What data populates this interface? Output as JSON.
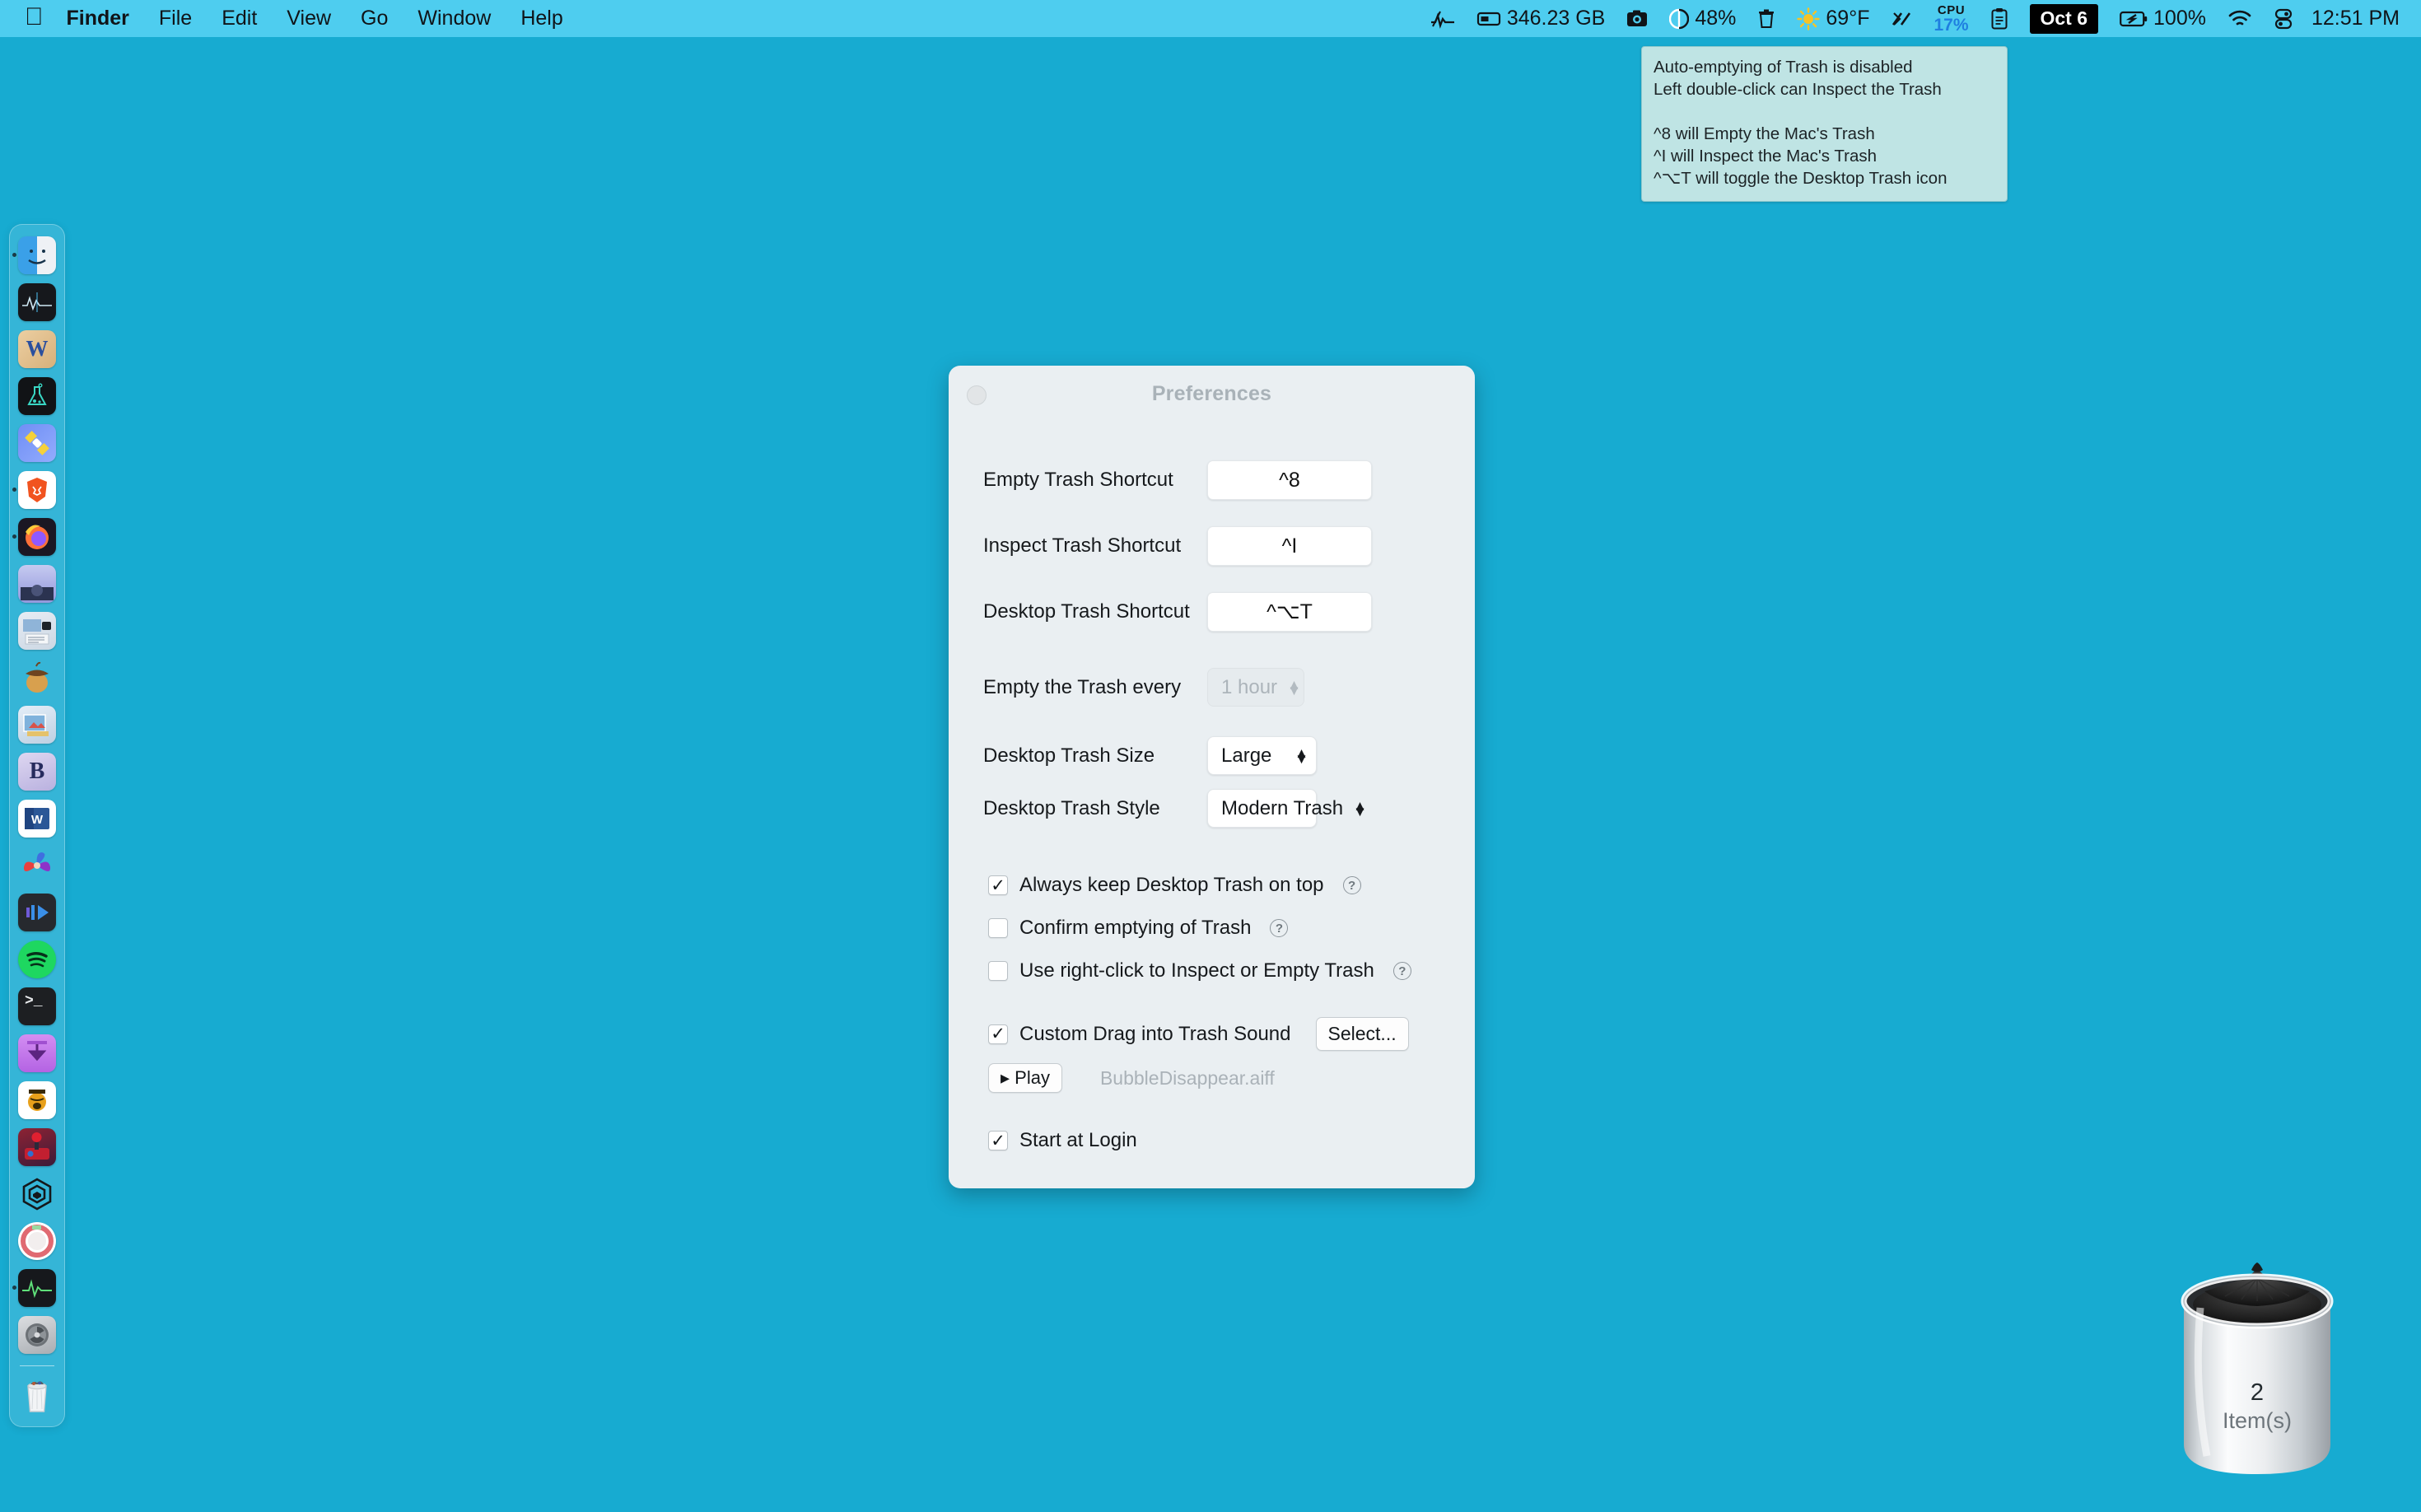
{
  "desktop": {
    "background_color": "#17abd1"
  },
  "menubar": {
    "background_color": "#4ecdef",
    "apple_glyph": "",
    "apps": [
      {
        "label": "Finder",
        "bold": true
      },
      {
        "label": "File",
        "bold": false
      },
      {
        "label": "Edit",
        "bold": false
      },
      {
        "label": "View",
        "bold": false
      },
      {
        "label": "Go",
        "bold": false
      },
      {
        "label": "Window",
        "bold": false
      },
      {
        "label": "Help",
        "bold": false
      }
    ],
    "status": {
      "signal_icon": "waveform-icon",
      "disk_icon": "disk-icon",
      "disk_free": "346.23 GB",
      "camera_icon": "camera-icon",
      "memory_icon": "pie-gauge-icon",
      "memory_pct": "48%",
      "trash_icon": "trash-icon",
      "weather_icon": "sun-icon",
      "weather_temp": "69°F",
      "network_icon": "network-activity-icon",
      "cpu_label": "CPU",
      "cpu_value": "17%",
      "cpu_color": "#1f7fe0",
      "clipboard_icon": "clipboard-icon",
      "date_badge": "Oct 6",
      "battery_icon": "battery-charging-icon",
      "battery_pct": "100%",
      "wifi_icon": "wifi-icon",
      "control_center_icon": "control-center-icon",
      "clock": "12:51 PM"
    }
  },
  "tooltip": {
    "background_color": "#bfe4e4",
    "line1": "Auto-emptying of Trash is disabled",
    "line2": "Left double-click can Inspect the Trash",
    "line3": "^8 will Empty the Mac's Trash",
    "line4": "^I will Inspect the Mac's Trash",
    "line5": "^⌥T will toggle the Desktop Trash icon"
  },
  "dock": {
    "items": [
      {
        "name": "finder",
        "glyph": "",
        "bg": "linear-gradient(135deg,#3fa9f5 0%,#3fa9f5 49%,#f2f4f7 49%,#e8ebef 100%)",
        "color": "#123",
        "running": true
      },
      {
        "name": "istat-menus",
        "glyph": "",
        "bg": "#16181c",
        "color": "#9de3ff",
        "running": false
      },
      {
        "name": "dictionary",
        "glyph": "W",
        "bg": "linear-gradient(135deg,#e6c79a,#d8b27e)",
        "color": "#2b4f9e",
        "running": false
      },
      {
        "name": "science-app",
        "glyph": "",
        "bg": "#111316",
        "color": "#39d7c4",
        "running": false
      },
      {
        "name": "satellite-app",
        "glyph": "",
        "bg": "linear-gradient(135deg,#6f8ef5,#8aa5fb)",
        "color": "#ffd84a",
        "running": false
      },
      {
        "name": "brave-browser",
        "glyph": "",
        "bg": "#ffffff",
        "color": "#f1531f",
        "running": true
      },
      {
        "name": "firefox",
        "glyph": "",
        "bg": "#1b1723",
        "color": "#ff9500",
        "running": true
      },
      {
        "name": "messages-app",
        "glyph": "",
        "bg": "linear-gradient(180deg,#c3c7ef,#8e93d8)",
        "color": "#2b3350",
        "running": false
      },
      {
        "name": "screenshot-app",
        "glyph": "",
        "bg": "linear-gradient(160deg,#dfe6ef,#c7d2de)",
        "color": "#1c2530",
        "running": false
      },
      {
        "name": "acorn-editor",
        "glyph": "",
        "bg": "transparent",
        "color": "#8a5a25",
        "running": false
      },
      {
        "name": "graphic-app",
        "glyph": "",
        "bg": "linear-gradient(160deg,#dfe9f4,#b9cde0)",
        "color": "#c94d3a",
        "running": false
      },
      {
        "name": "bookends-app",
        "glyph": "B",
        "bg": "linear-gradient(160deg,#d9d3ee,#bdb5e0)",
        "color": "#2b2f63",
        "running": false
      },
      {
        "name": "microsoft-word",
        "glyph": "W",
        "bg": "#ffffff",
        "color": "#2b5797",
        "running": false
      },
      {
        "name": "swirl-app",
        "glyph": "",
        "bg": "transparent",
        "color": "#8d33c8",
        "running": false
      },
      {
        "name": "media-player",
        "glyph": "▶",
        "bg": "#26292e",
        "color": "#5fb9ff",
        "running": false
      },
      {
        "name": "spotify",
        "glyph": "",
        "bg": "#1ed760",
        "color": "#0a2a14",
        "running": false
      },
      {
        "name": "terminal",
        "glyph": ">_",
        "bg": "#1d1f22",
        "color": "#e8eaec",
        "running": false
      },
      {
        "name": "downloads-app",
        "glyph": "↓",
        "bg": "linear-gradient(180deg,#cf83f0,#b463e3)",
        "color": "#5c2480",
        "running": false
      },
      {
        "name": "audio-hijack",
        "glyph": "",
        "bg": "#ffffff",
        "color": "#e8a01b",
        "running": false
      },
      {
        "name": "game-emulator",
        "glyph": "",
        "bg": "linear-gradient(160deg,#7b1f2e,#3b1c3a)",
        "color": "#e02030",
        "running": false
      },
      {
        "name": "hex-app",
        "glyph": "",
        "bg": "transparent",
        "color": "#14181b",
        "running": false
      },
      {
        "name": "record-app",
        "glyph": "",
        "bg": "#ffffff",
        "color": "#e06a72",
        "running": false
      },
      {
        "name": "activity-monitor",
        "glyph": "",
        "bg": "#16181c",
        "color": "#5fe07a",
        "running": true
      },
      {
        "name": "system-settings",
        "glyph": "",
        "bg": "linear-gradient(160deg,#d8dadd,#a9adb2)",
        "color": "#4a4f54",
        "running": false
      }
    ],
    "trash": {
      "name": "dock-trash",
      "label": "Trash"
    }
  },
  "prefs": {
    "title": "Preferences",
    "close_button": "close-button",
    "shortcut_rows": [
      {
        "label": "Empty Trash Shortcut",
        "value": "^8",
        "name": "empty-trash-shortcut"
      },
      {
        "label": "Inspect Trash Shortcut",
        "value": "^I",
        "name": "inspect-trash-shortcut"
      },
      {
        "label": "Desktop Trash Shortcut",
        "value": "^⌥T",
        "name": "desktop-trash-shortcut"
      }
    ],
    "interval": {
      "label": "Empty the Trash every",
      "value": "1 hour",
      "disabled": true
    },
    "size": {
      "label": "Desktop Trash Size",
      "value": "Large"
    },
    "style": {
      "label": "Desktop Trash Style",
      "value": "Modern Trash"
    },
    "checkboxes": [
      {
        "label": "Always keep Desktop Trash on top",
        "checked": true,
        "help": true,
        "mark": "✓"
      },
      {
        "label": "Confirm emptying of Trash",
        "checked": false,
        "help": true,
        "mark": "✓"
      },
      {
        "label": "Use right-click to Inspect or Empty Trash",
        "checked": false,
        "help": true,
        "mark": "✓"
      }
    ],
    "sound": {
      "label": "Custom Drag into Trash Sound",
      "checked": true,
      "mark": "✓",
      "select_button": "Select...",
      "play_button": "▸ Play",
      "file_name": "BubbleDisappear.aiff"
    },
    "startup": {
      "label": "Start at Login",
      "checked": true,
      "mark": "✓"
    },
    "help_glyph": "?"
  },
  "desktop_trash": {
    "name": "desktop-trash-icon",
    "count": "2",
    "count_label": "Item(s)"
  }
}
